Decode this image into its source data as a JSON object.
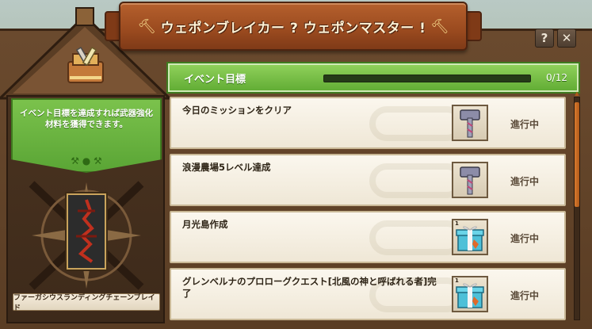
{
  "window": {
    "title": "ウェポンブレイカー ? ウェポンマスター !",
    "help_label": "?",
    "close_label": "✕"
  },
  "left": {
    "goal_text": "イベント目標を達成すれば武器強化材料を獲得できます。",
    "weapon_name": "ファーガシウスランディングチェーンブレイド"
  },
  "header": {
    "title": "イベント目標",
    "progress_text": "0/12",
    "progress_fraction": 0.0
  },
  "missions": [
    {
      "label": "今日のミッションをクリア",
      "reward_icon": "hammer-icon",
      "reward_count": "",
      "status": "進行中"
    },
    {
      "label": "浪漫農場5レベル達成",
      "reward_icon": "hammer-icon",
      "reward_count": "",
      "status": "進行中"
    },
    {
      "label": "月光島作成",
      "reward_icon": "gift-box-icon",
      "reward_count": "1",
      "status": "進行中"
    },
    {
      "label": "グレンベルナのプロローグクエスト[北風の神と呼ばれる者]完了",
      "reward_icon": "gift-box-icon",
      "reward_count": "1",
      "status": "進行中"
    }
  ],
  "colors": {
    "accent_green": "#62ad35",
    "ribbon_brown": "#9a4a1f",
    "scroll_orange": "#d77a2e"
  }
}
